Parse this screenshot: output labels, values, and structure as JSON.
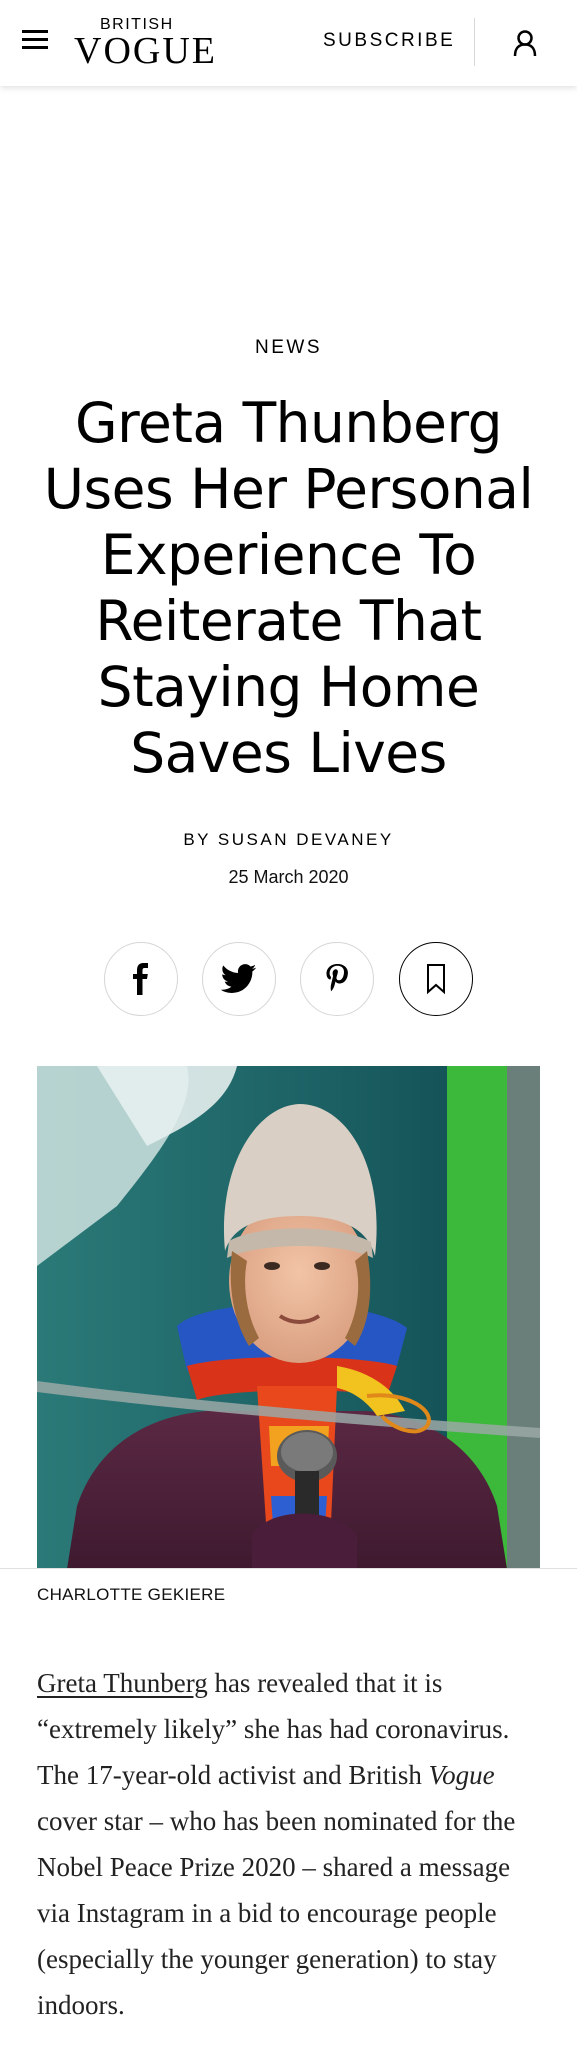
{
  "header": {
    "logo_top": "BRITISH",
    "logo_main": "VOGUE",
    "subscribe_label": "SUBSCRIBE",
    "icons": [
      "menu-icon",
      "account-icon"
    ]
  },
  "article": {
    "rubric": "NEWS",
    "headline": "Greta Thunberg Uses Her Personal Experience To Reiterate That Staying Home Saves Lives",
    "byline": "BY SUSAN DEVANEY",
    "date": "25 March 2020",
    "share_icons": [
      "facebook-icon",
      "twitter-icon",
      "pinterest-icon",
      "bookmark-icon"
    ],
    "photo_credit": "CHARLOTTE GEKIERE",
    "body": {
      "link_text": "Greta Thunberg",
      "text_1": " has revealed that it is “extremely likely” she has had coronavirus. The 17-year-old activist and British ",
      "italic": "Vogue",
      "text_2": " cover star – who has been nominated for the Nobel Peace Prize 2020 – shared a message via Instagram in a bid to encourage people (especially the younger generation) to stay indoors."
    }
  },
  "colors": {
    "text": "#000000",
    "divider": "#e0e0e0",
    "photo_bg_teal": "#1f6e6a",
    "photo_green": "#3cb83a"
  }
}
